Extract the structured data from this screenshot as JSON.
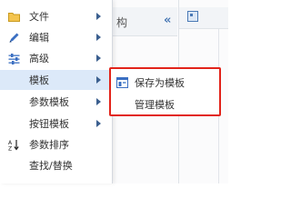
{
  "background": {
    "header_text": "构",
    "collapse_glyph": "«"
  },
  "menu": {
    "items": [
      {
        "label": "文件",
        "icon": "folder-icon",
        "has_submenu": true
      },
      {
        "label": "编辑",
        "icon": "pencil-icon",
        "has_submenu": true
      },
      {
        "label": "高级",
        "icon": "sliders-icon",
        "has_submenu": true
      },
      {
        "label": "模板",
        "icon": "",
        "has_submenu": true,
        "active": true
      },
      {
        "label": "参数模板",
        "icon": "",
        "has_submenu": true
      },
      {
        "label": "按钮模板",
        "icon": "",
        "has_submenu": true
      },
      {
        "label": "参数排序",
        "icon": "sort-az-icon",
        "has_submenu": false
      },
      {
        "label": "查找/替换",
        "icon": "",
        "has_submenu": false
      }
    ]
  },
  "submenu": {
    "items": [
      {
        "label": "保存为模板",
        "icon": "save-template-icon"
      },
      {
        "label": "管理模板",
        "icon": ""
      }
    ]
  },
  "colors": {
    "accent": "#3b5f8f",
    "highlight": "#e2231a",
    "active_bg": "#dce9f9"
  }
}
